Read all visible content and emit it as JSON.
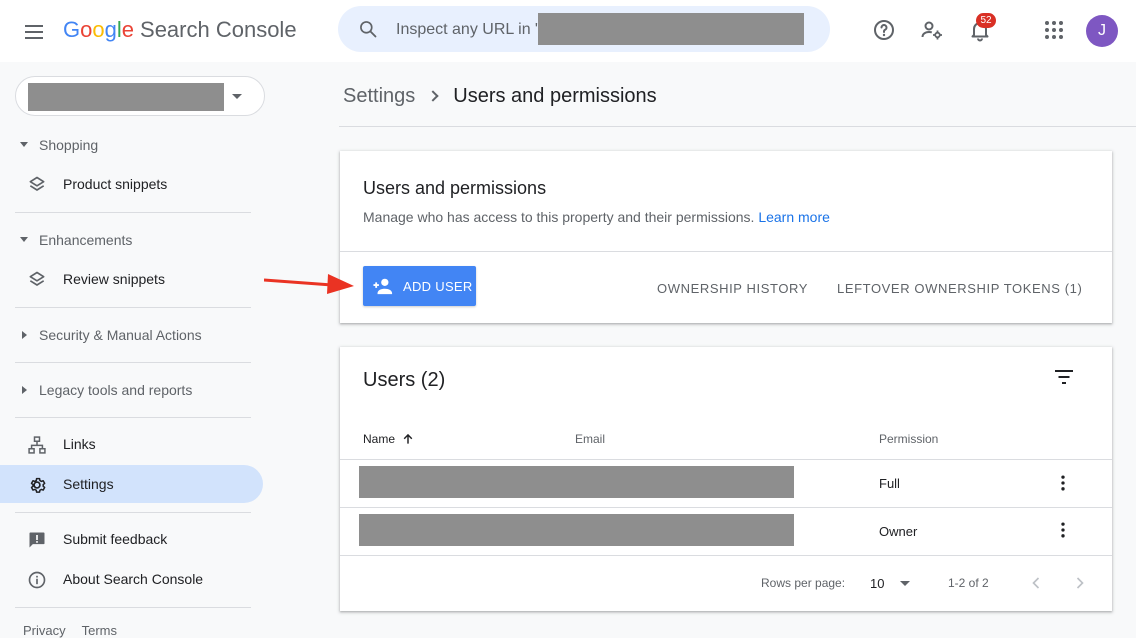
{
  "app": {
    "logo_letters": [
      "G",
      "o",
      "o",
      "g",
      "l",
      "e"
    ],
    "logo_product": "Search Console",
    "avatar_initial": "J",
    "notification_count": "52"
  },
  "search": {
    "placeholder": "Inspect any URL in \""
  },
  "sidebar": {
    "sections": [
      {
        "label": "Shopping",
        "expanded": true
      },
      {
        "label": "Enhancements",
        "expanded": true
      },
      {
        "label": "Security & Manual Actions",
        "expanded": false
      },
      {
        "label": "Legacy tools and reports",
        "expanded": false
      }
    ],
    "items": {
      "product_snippets": "Product snippets",
      "review_snippets": "Review snippets",
      "links": "Links",
      "settings": "Settings",
      "submit_feedback": "Submit feedback",
      "about": "About Search Console"
    },
    "footer": {
      "privacy": "Privacy",
      "terms": "Terms"
    }
  },
  "breadcrumb": {
    "root": "Settings",
    "current": "Users and permissions"
  },
  "permissions_card": {
    "title": "Users and permissions",
    "subtitle": "Manage who has access to this property and their permissions.",
    "learn_more": "Learn more",
    "add_user_label": "ADD USER",
    "ownership_history_label": "OWNERSHIP HISTORY",
    "leftover_tokens_label": "LEFTOVER OWNERSHIP TOKENS (1)"
  },
  "users_card": {
    "title": "Users (2)",
    "columns": {
      "name": "Name",
      "email": "Email",
      "permission": "Permission"
    },
    "rows": [
      {
        "permission": "Full"
      },
      {
        "permission": "Owner"
      }
    ],
    "pagination": {
      "rows_per_page_label": "Rows per page:",
      "rows_per_page_value": "10",
      "range": "1-2 of 2"
    }
  },
  "colors": {
    "accent": "#4285f4",
    "active_nav": "#d2e3fc",
    "search_bg": "#e8f0fe",
    "annotation_arrow": "#ea3323",
    "badge": "#d93025",
    "avatar": "#7e57c2"
  }
}
